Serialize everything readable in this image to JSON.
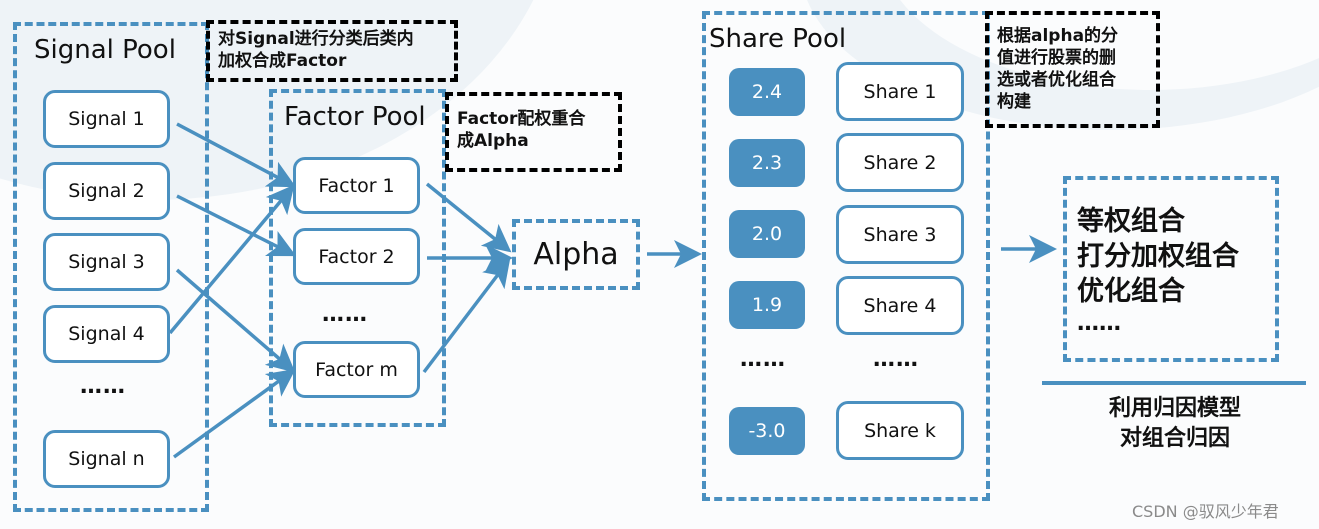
{
  "signal_pool": {
    "title": "Signal Pool",
    "items": [
      "Signal 1",
      "Signal 2",
      "Signal 3",
      "Signal 4",
      "Signal n"
    ],
    "ellipsis": "……"
  },
  "notes": {
    "signal_to_factor": [
      "对Signal进行分类后类内",
      "加权合成Factor"
    ],
    "factor_to_alpha": [
      "Factor配权重合",
      "成Alpha"
    ],
    "share_selection": [
      "根据alpha的分",
      "值进行股票的删",
      "选或者优化组合",
      "构建"
    ]
  },
  "factor_pool": {
    "title": "Factor Pool",
    "items": [
      "Factor 1",
      "Factor 2",
      "Factor m"
    ],
    "ellipsis": "……"
  },
  "alpha": {
    "label": "Alpha"
  },
  "share_pool": {
    "title": "Share Pool",
    "rows": [
      {
        "score": "2.4",
        "share": "Share 1"
      },
      {
        "score": "2.3",
        "share": "Share 2"
      },
      {
        "score": "2.0",
        "share": "Share 3"
      },
      {
        "score": "1.9",
        "share": "Share 4"
      },
      {
        "score": "-3.0",
        "share": "Share k"
      }
    ],
    "ellipsis": "……"
  },
  "portfolio": {
    "methods": [
      "等权组合",
      "打分加权组合",
      "优化组合"
    ],
    "ellipsis": "……"
  },
  "attribution": [
    "利用归因模型",
    "对组合归因"
  ],
  "connections": {
    "signal_to_factor": [
      [
        "Signal 1",
        "Factor 1"
      ],
      [
        "Signal 2",
        "Factor 2"
      ],
      [
        "Signal 3",
        "Factor m"
      ],
      [
        "Signal 4",
        "Factor 1"
      ],
      [
        "Signal n",
        "Factor m"
      ]
    ],
    "factor_to_alpha": [
      [
        "Factor 1",
        "Alpha"
      ],
      [
        "Factor 2",
        "Alpha"
      ],
      [
        "Factor m",
        "Alpha"
      ]
    ],
    "alpha_to_share_pool": true,
    "share_pool_to_portfolio": true
  },
  "colors": {
    "accent": "#4a90c0",
    "note_border": "#000000",
    "background": "#fbfcfd"
  },
  "watermark": "CSDN @驭风少年君"
}
